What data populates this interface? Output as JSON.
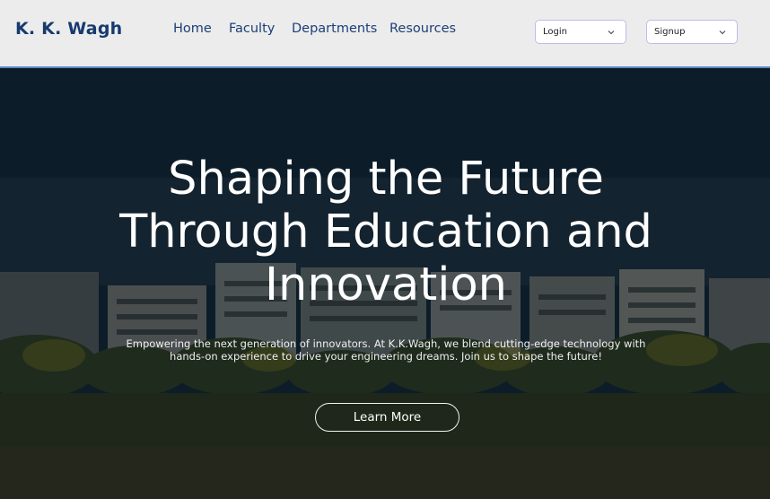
{
  "brand": {
    "name": "K. K. Wagh"
  },
  "nav": {
    "links": [
      {
        "label": "Home"
      },
      {
        "label": "Faculty"
      },
      {
        "label": "Departments"
      },
      {
        "label": "Resources"
      }
    ],
    "login": {
      "label": "Login",
      "icon": "chevron-down-icon"
    },
    "signup": {
      "label": "Signup",
      "icon": "chevron-down-icon"
    }
  },
  "hero": {
    "title_lines": [
      "Shaping the Future",
      "Through Education and",
      "Innovation"
    ],
    "subtitle_lines": [
      "Empowering the next generation of innovators. At K.K.Wagh, we blend cutting-edge technology with",
      "hands-on experience to drive your engineering dreams. Join us to shape the future!"
    ],
    "cta_label": "Learn More"
  },
  "colors": {
    "brand": "#163a6e",
    "nav_link": "#1b3f78",
    "header_bg": "#ececec",
    "header_border": "#5b84c8",
    "select_border": "#c9b7ea",
    "hero_text": "#ffffff"
  }
}
